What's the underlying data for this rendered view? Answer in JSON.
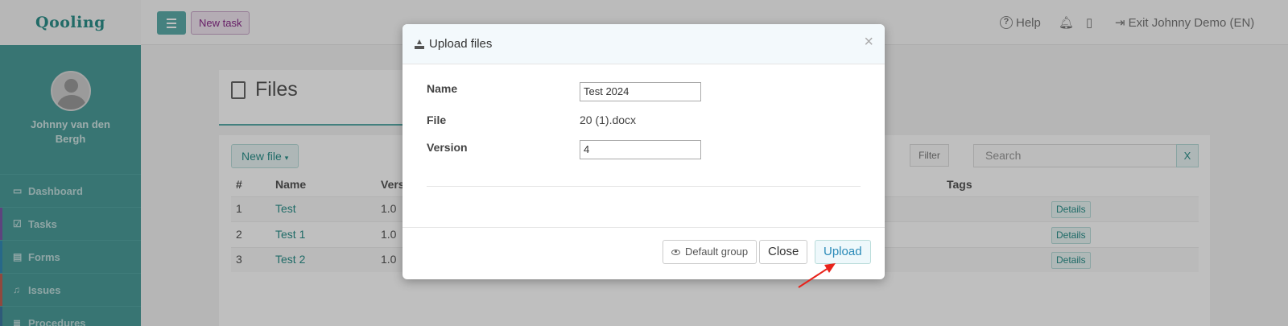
{
  "app": {
    "logo": "Qooling",
    "new_task": "New task",
    "help": "Help",
    "exit": "Exit Johnny Demo (EN)"
  },
  "sidebar": {
    "username": "Johnny van den Bergh",
    "items": [
      {
        "label": "Dashboard",
        "icon": "monitor-icon",
        "color": "#4b9d9a"
      },
      {
        "label": "Tasks",
        "icon": "checkbox-icon",
        "color": "#8e44ad"
      },
      {
        "label": "Forms",
        "icon": "document-icon",
        "color": "#2e86c1"
      },
      {
        "label": "Issues",
        "icon": "bell-icon",
        "color": "#e74c3c"
      },
      {
        "label": "Procedures",
        "icon": "list-icon",
        "color": "#3a6ea5"
      }
    ]
  },
  "main": {
    "title": "Files",
    "new_file": "New file",
    "filter": "Filter",
    "search_placeholder": "Search",
    "clear": "X",
    "columns": [
      "#",
      "Name",
      "Vers",
      "Tags"
    ],
    "rows": [
      {
        "num": "1",
        "name": "Test",
        "version": "1.0",
        "action": "Details"
      },
      {
        "num": "2",
        "name": "Test 1",
        "version": "1.0",
        "action": "Details"
      },
      {
        "num": "3",
        "name": "Test 2",
        "version": "1.0",
        "action": "Details"
      }
    ]
  },
  "modal": {
    "title": "Upload files",
    "name_label": "Name",
    "name_value": "Test 2024",
    "file_label": "File",
    "file_value": "20 (1).docx",
    "version_label": "Version",
    "version_value": "4",
    "default_group": "Default group",
    "close": "Close",
    "upload": "Upload"
  },
  "colors": {
    "accent": "#4b9d9a",
    "annotation_arrow": "#e8231b"
  }
}
